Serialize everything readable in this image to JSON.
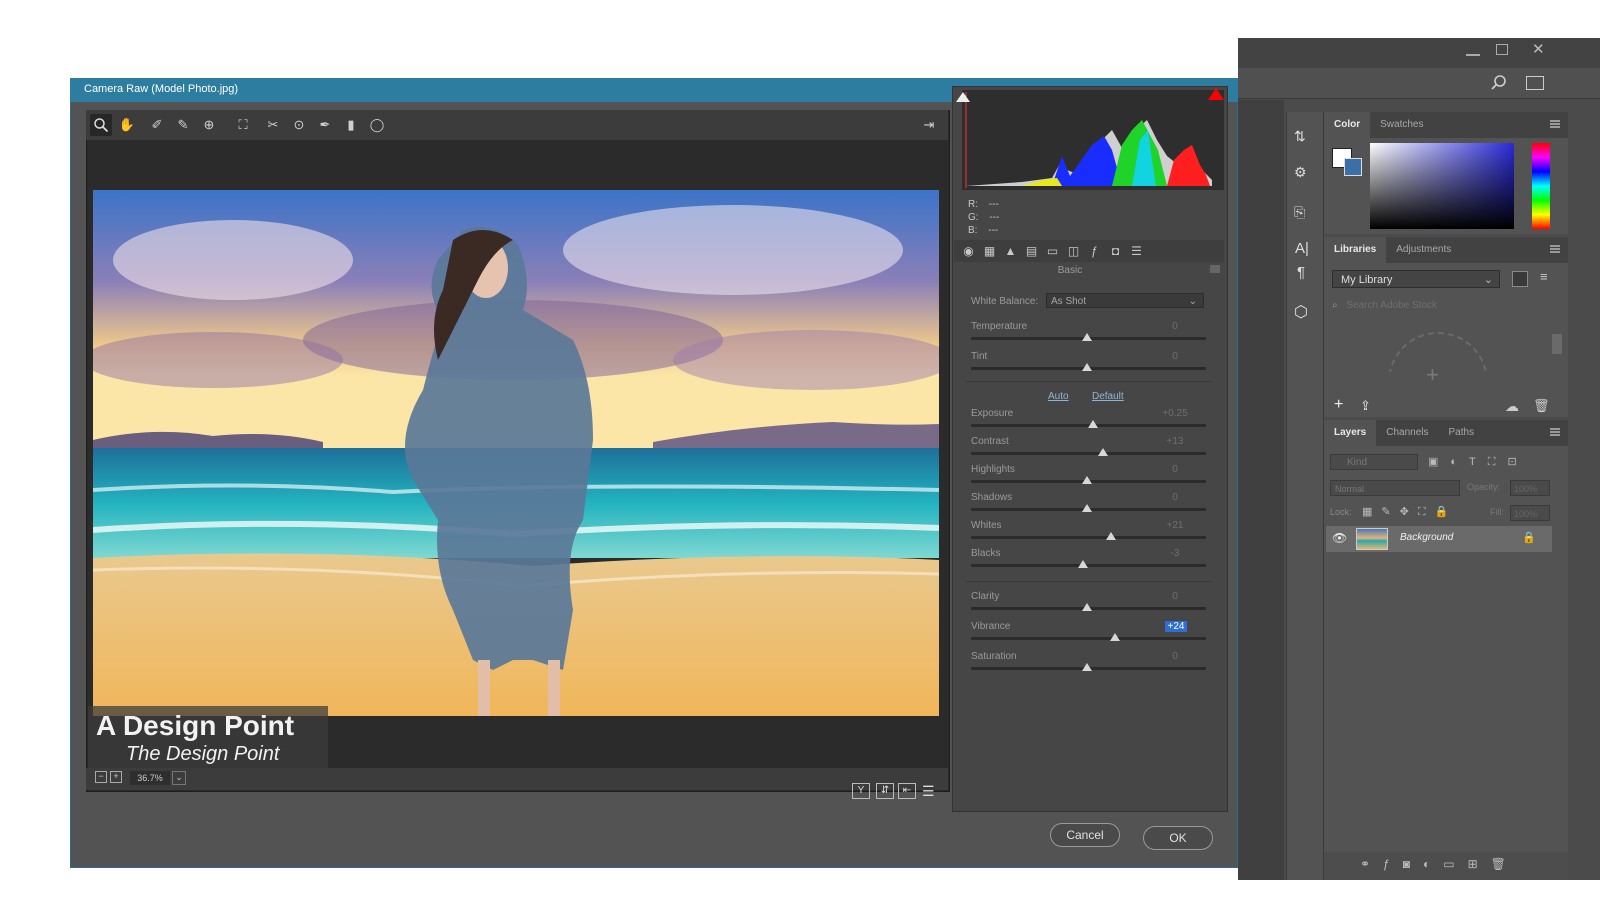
{
  "dialog": {
    "title": "Camera Raw (Model Photo.jpg)",
    "zoom": "36.7%",
    "cancel_label": "Cancel",
    "ok_label": "OK"
  },
  "watermark": {
    "line1": "A Design Point",
    "line2": "The Design Point"
  },
  "histogram": {
    "r_label": "R:",
    "r_value": "---",
    "g_label": "G:",
    "g_value": "---",
    "b_label": "B:",
    "b_value": "---"
  },
  "basic": {
    "section_title": "Basic",
    "white_balance_label": "White Balance:",
    "white_balance_value": "As Shot",
    "auto_label": "Auto",
    "default_label": "Default",
    "sliders": [
      {
        "label": "Temperature",
        "value": "0"
      },
      {
        "label": "Tint",
        "value": "0"
      },
      {
        "label": "Exposure",
        "value": "+0.25"
      },
      {
        "label": "Contrast",
        "value": "+13"
      },
      {
        "label": "Highlights",
        "value": "0"
      },
      {
        "label": "Shadows",
        "value": "0"
      },
      {
        "label": "Whites",
        "value": "+21"
      },
      {
        "label": "Blacks",
        "value": "-3"
      },
      {
        "label": "Clarity",
        "value": "0"
      },
      {
        "label": "Vibrance",
        "value": "+24"
      },
      {
        "label": "Saturation",
        "value": "0"
      }
    ]
  },
  "photoshop": {
    "color_tabs": [
      "Color",
      "Swatches"
    ],
    "library_tabs": [
      "Libraries",
      "Adjustments"
    ],
    "library_select": "My Library",
    "stock_search_placeholder": "Search Adobe Stock",
    "layer_tabs": [
      "Layers",
      "Channels",
      "Paths"
    ],
    "kind_filter": "Kind",
    "blend_mode": "Normal",
    "opacity_label": "Opacity:",
    "opacity_value": "100%",
    "lock_label": "Lock:",
    "fill_label": "Fill:",
    "fill_value": "100%",
    "layer_name": "Background"
  },
  "colors": {
    "dialog_title_bar": "#2d7da0",
    "panel_bg": "#535353",
    "vibrance_highlight": "#2e6fd6"
  }
}
